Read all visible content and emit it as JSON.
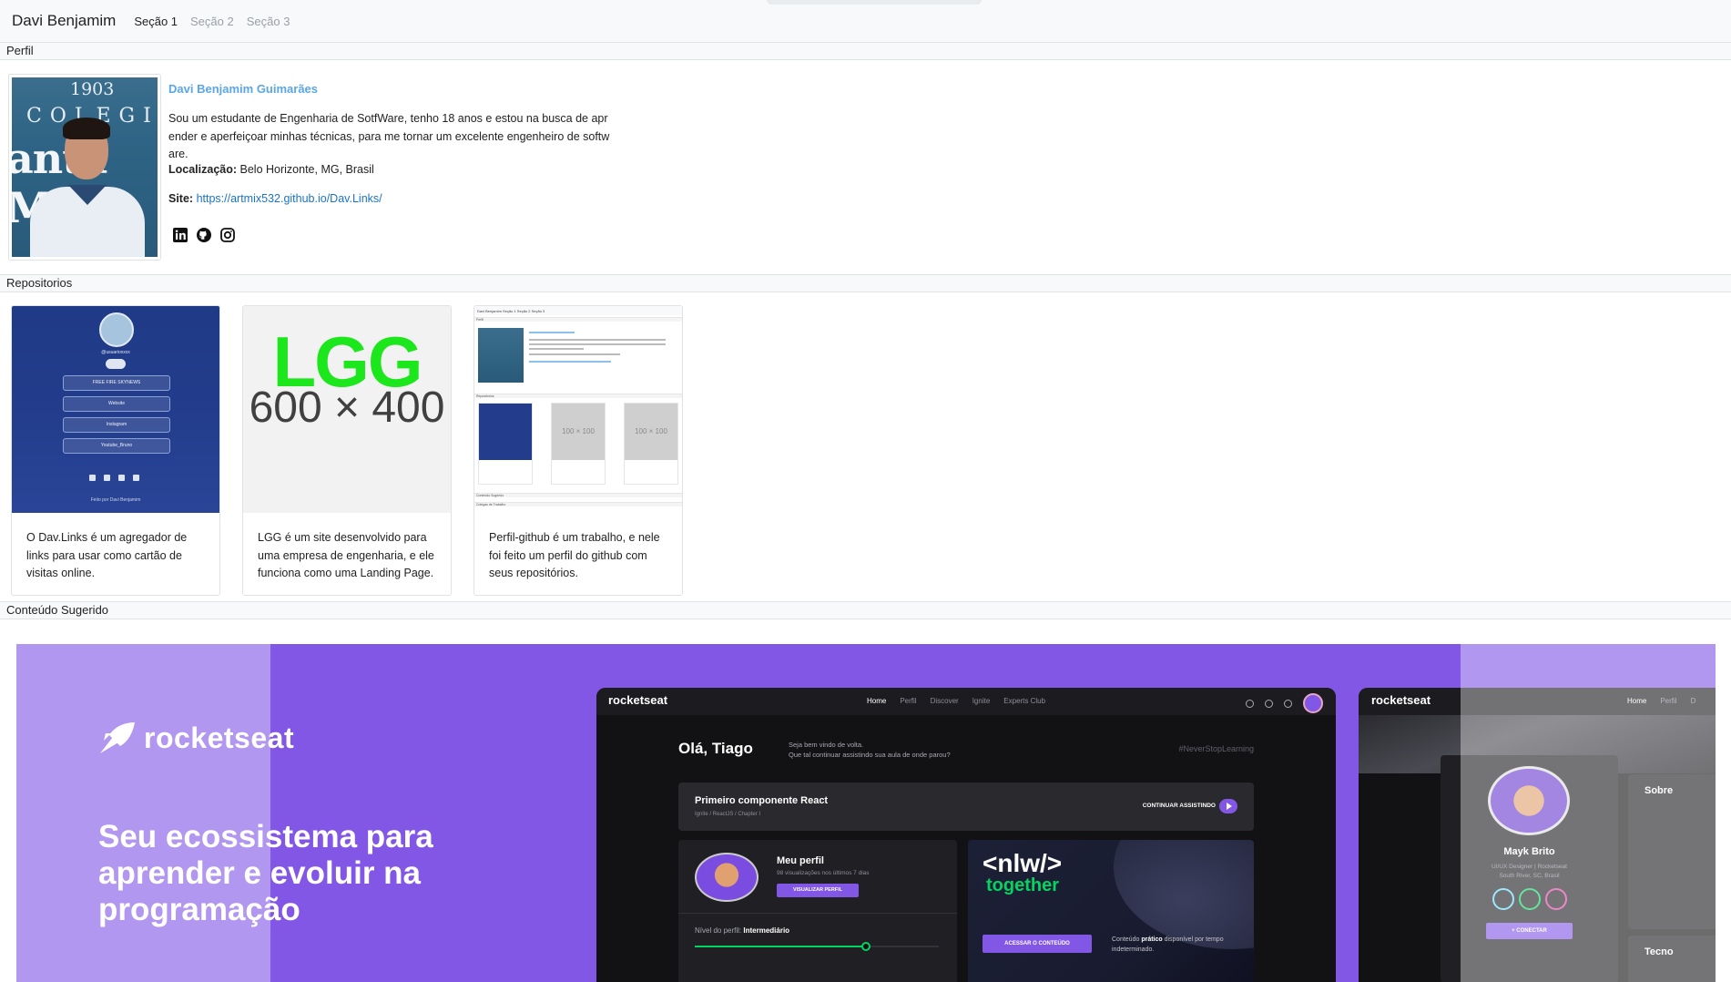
{
  "navbar": {
    "brand": "Davi Benjamim",
    "links": [
      "Seção 1",
      "Seção 2",
      "Seção 3"
    ]
  },
  "sections": {
    "profile": "Perfil",
    "repos": "Repositorios",
    "suggested": "Conteúdo Sugerido"
  },
  "profile": {
    "name": "Davi Benjamim Guimarães",
    "bio": "Sou um estudante de Engenharia de SotfWare, tenho 18 anos e estou na busca de aprender e aperfeiçoar minhas técnicas, para me tornar um excelente engenheiro de software.",
    "location_label": "Localização:",
    "location": "Belo Horizonte, MG, Brasil",
    "site_label": "Site:",
    "site_url": "https://artmix532.github.io/Dav.Links/",
    "photo_text": {
      "year": "1903",
      "college": "COLEGIO",
      "anta": "anta Mar"
    },
    "socials": [
      "linkedin-icon",
      "github-icon",
      "instagram-icon"
    ]
  },
  "repos": [
    {
      "text": "O Dav.Links é um agregador de links para usar como cartão de visitas online.",
      "thumb": {
        "user": "@usuarioxxxx",
        "buttons": [
          "FREE FIRE SKYNEWS",
          "Website",
          "Instagram",
          "Youtube_Bruno"
        ],
        "footer": "Feito por Davi Benjamim"
      }
    },
    {
      "text": "LGG é um site desenvolvido para uma empresa de engenharia, e ele funciona como uma Landing Page.",
      "thumb": {
        "title": "LGG",
        "dimensions": "600 × 400"
      }
    },
    {
      "text": "Perfil-github é um trabalho, e nele foi feito um perfil do github com seus repositórios.",
      "thumb": {
        "nav": "Davi Benjamim  Seção 1  Seção 2  Seção 3",
        "perfil": "Perfil",
        "repos": "Repositorios",
        "placeholder": "100 × 100",
        "suggested": "Conteúdo Sugerido",
        "footer": "Colegas de Trabalho"
      }
    }
  ],
  "hero": {
    "logo": "rocketseat",
    "title": "Seu ecossistema para aprender e evoluir na programação",
    "dashboard": {
      "logo": "rocketseat",
      "nav": [
        "Home",
        "Perfil",
        "Discover",
        "Ignite",
        "Experts Club"
      ],
      "hello": "Olá, Tiago",
      "welcome": [
        "Seja bem vindo de volta.",
        "Que tal continuar assistindo sua aula de onde parou?"
      ],
      "tag": "#NeverStopLearning",
      "course_title": "Primeiro componente React",
      "crumbs": "Ignite  /  ReactJS  /  Chapter I",
      "continue": "CONTINUAR ASSISTINDO",
      "my_profile": "Meu perfil",
      "views": "98 visualizações nos últimos 7 dias",
      "view_profile": "VISUALIZAR PERFIL",
      "level_label": "Nível do perfil:",
      "level": "Intermediário",
      "level_progress": 0.7,
      "nlw_1": "<nlw/>",
      "nlw_2": "together",
      "access": "ACESSAR O CONTEÚDO",
      "note_pre": "Conteúdo",
      "note_bold": "prático",
      "note_post": "disponível por tempo indeterminado."
    },
    "dashboard2": {
      "logo": "rocketseat",
      "nav": [
        "Home",
        "Perfil",
        "D"
      ],
      "name": "Mayk Brito",
      "role": [
        "UI/UX Designer | Rocketseat",
        "South River, SC, Brasil"
      ],
      "connect": "+  CONECTAR",
      "about": "Sobre",
      "tech": "Tecno"
    }
  },
  "colors": {
    "accent": "#8257e5",
    "link": "#1a73c9",
    "name": "#5aa6e6",
    "green": "#04d361",
    "lgg": "#1ce61c"
  }
}
